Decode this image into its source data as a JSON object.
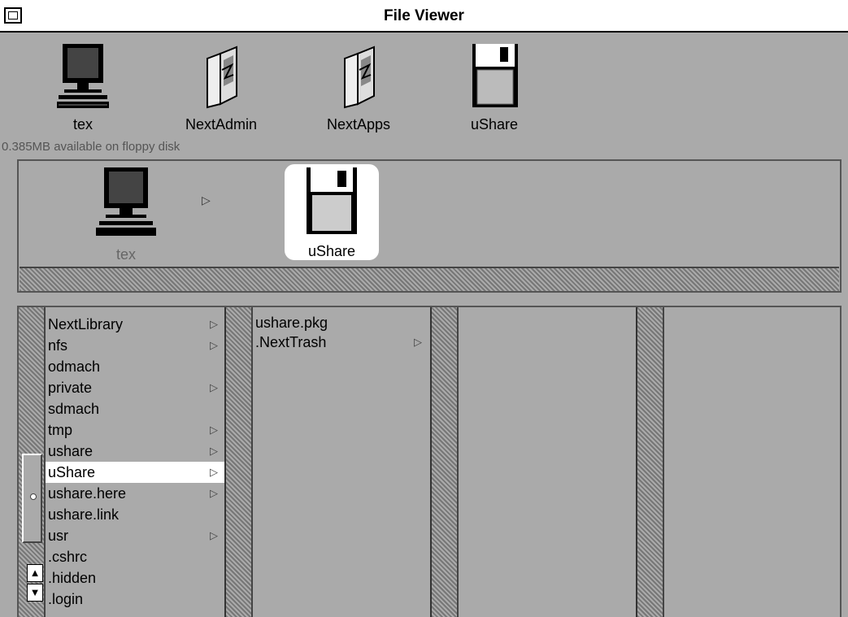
{
  "window": {
    "title": "File Viewer"
  },
  "shelf": {
    "items": [
      {
        "label": "tex",
        "icon": "computer-icon"
      },
      {
        "label": "NextAdmin",
        "icon": "folder-book-icon"
      },
      {
        "label": "NextApps",
        "icon": "folder-book-icon"
      },
      {
        "label": "uShare",
        "icon": "floppy-disk-icon"
      }
    ],
    "disk_info": "0.385MB available on floppy disk"
  },
  "path": {
    "items": [
      {
        "label": "tex",
        "icon": "computer-icon"
      },
      {
        "label": "uShare",
        "icon": "floppy-disk-icon",
        "selected": true
      }
    ]
  },
  "browser": {
    "column1": [
      {
        "name": "NextLibrary",
        "dir": true
      },
      {
        "name": "nfs",
        "dir": true
      },
      {
        "name": "odmach",
        "dir": false
      },
      {
        "name": "private",
        "dir": true
      },
      {
        "name": "sdmach",
        "dir": false
      },
      {
        "name": "tmp",
        "dir": true
      },
      {
        "name": "ushare",
        "dir": true
      },
      {
        "name": "uShare",
        "dir": true,
        "selected": true
      },
      {
        "name": "ushare.here",
        "dir": true
      },
      {
        "name": "ushare.link",
        "dir": false
      },
      {
        "name": "usr",
        "dir": true
      },
      {
        "name": ".cshrc",
        "dir": false
      },
      {
        "name": ".hidden",
        "dir": false
      },
      {
        "name": ".login",
        "dir": false
      }
    ],
    "column2": [
      {
        "name": "ushare.pkg",
        "dir": false
      },
      {
        "name": ".NextTrash",
        "dir": true
      }
    ]
  },
  "glyphs": {
    "arrow": "▷",
    "up": "▲",
    "down": "▼"
  },
  "colors": {
    "background": "#aaaaaa",
    "selection": "#ffffff"
  }
}
